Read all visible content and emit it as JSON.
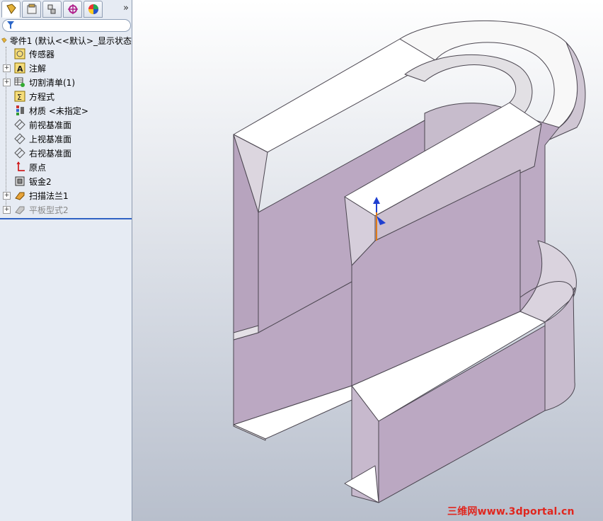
{
  "tabs": [
    {
      "name": "featuremanager",
      "icon": "part-tree-icon"
    },
    {
      "name": "propertymanager",
      "icon": "property-icon"
    },
    {
      "name": "configurationmanager",
      "icon": "config-icon"
    },
    {
      "name": "dimxpert",
      "icon": "crosshair-icon"
    },
    {
      "name": "displaymanager",
      "icon": "color-wheel-icon"
    }
  ],
  "more_tabs": "»",
  "tree": {
    "root": "零件1 (默认<<默认>_显示状态",
    "items": [
      {
        "label": "传感器",
        "icon": "sensor-icon",
        "expand": false
      },
      {
        "label": "注解",
        "icon": "annotation-icon",
        "expand": true
      },
      {
        "label": "切割清单(1)",
        "icon": "cutlist-icon",
        "expand": true
      },
      {
        "label": "方程式",
        "icon": "equation-icon",
        "expand": false
      },
      {
        "label": "材质 <未指定>",
        "icon": "material-icon",
        "expand": false
      },
      {
        "label": "前视基准面",
        "icon": "plane-icon",
        "expand": false
      },
      {
        "label": "上视基准面",
        "icon": "plane-icon",
        "expand": false
      },
      {
        "label": "右视基准面",
        "icon": "plane-icon",
        "expand": false
      },
      {
        "label": "原点",
        "icon": "origin-icon",
        "expand": false
      },
      {
        "label": "钣金2",
        "icon": "sheetmetal-icon",
        "expand": false
      },
      {
        "label": "扫描法兰1",
        "icon": "swept-flange-icon",
        "expand": true
      },
      {
        "label": "平板型式2",
        "icon": "flat-pattern-icon",
        "expand": true,
        "dim": true
      }
    ]
  },
  "watermark": "三维网www.3dportal.cn",
  "colors": {
    "face": "#bba8c2",
    "face_light": "#ffffff",
    "accent": "#2f62c4",
    "watermark": "#e0261e"
  }
}
